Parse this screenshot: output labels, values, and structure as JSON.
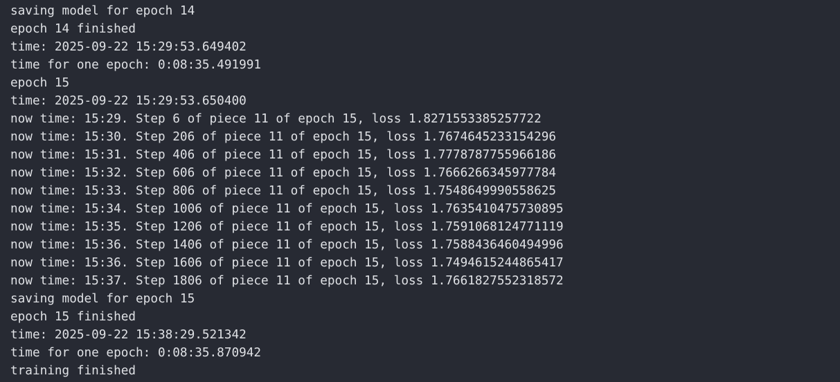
{
  "console": {
    "lines": [
      "saving model for epoch 14",
      "epoch 14 finished",
      "time: 2025-09-22 15:29:53.649402",
      "time for one epoch: 0:08:35.491991",
      "epoch 15",
      "time: 2025-09-22 15:29:53.650400",
      "now time: 15:29. Step 6 of piece 11 of epoch 15, loss 1.8271553385257722",
      "now time: 15:30. Step 206 of piece 11 of epoch 15, loss 1.7674645233154296",
      "now time: 15:31. Step 406 of piece 11 of epoch 15, loss 1.7778787755966186",
      "now time: 15:32. Step 606 of piece 11 of epoch 15, loss 1.7666266345977784",
      "now time: 15:33. Step 806 of piece 11 of epoch 15, loss 1.7548649990558625",
      "now time: 15:34. Step 1006 of piece 11 of epoch 15, loss 1.7635410475730895",
      "now time: 15:35. Step 1206 of piece 11 of epoch 15, loss 1.7591068124771119",
      "now time: 15:36. Step 1406 of piece 11 of epoch 15, loss 1.7588436460494996",
      "now time: 15:36. Step 1606 of piece 11 of epoch 15, loss 1.7494615244865417",
      "now time: 15:37. Step 1806 of piece 11 of epoch 15, loss 1.7661827552318572",
      "saving model for epoch 15",
      "epoch 15 finished",
      "time: 2025-09-22 15:38:29.521342",
      "time for one epoch: 0:08:35.870942",
      "training finished"
    ]
  }
}
